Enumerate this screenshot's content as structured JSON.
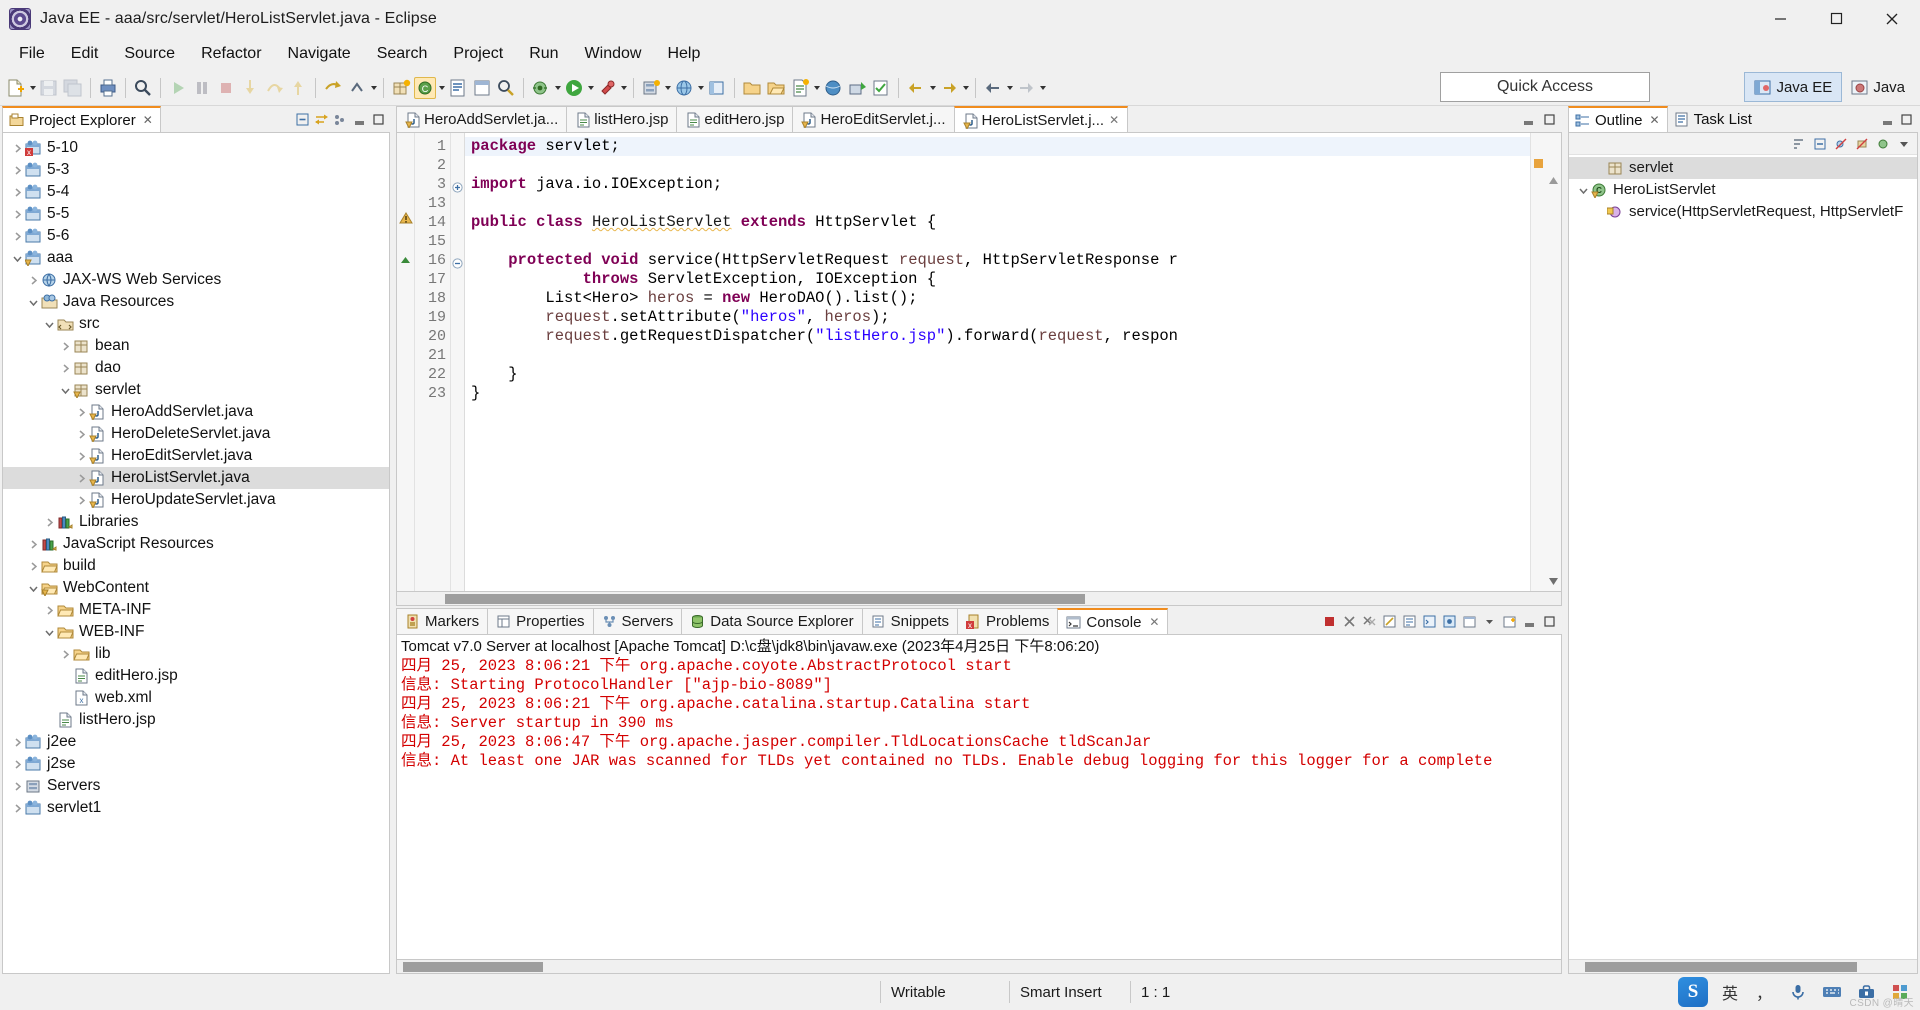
{
  "window": {
    "title": "Java EE - aaa/src/servlet/HeroListServlet.java - Eclipse",
    "minimize_label": "Minimize",
    "maximize_label": "Restore",
    "close_label": "Close"
  },
  "menubar": {
    "items": [
      "File",
      "Edit",
      "Source",
      "Refactor",
      "Navigate",
      "Search",
      "Project",
      "Run",
      "Window",
      "Help"
    ]
  },
  "toolbar": {
    "quick_access_label": "Quick Access",
    "perspectives": [
      {
        "label": "Java EE",
        "active": true
      },
      {
        "label": "Java",
        "active": false
      }
    ]
  },
  "project_explorer": {
    "tab_label": "Project Explorer",
    "tree": [
      {
        "label": "5-10",
        "indent": 0,
        "arrow": "right",
        "icon": "project-error-icon"
      },
      {
        "label": "5-3",
        "indent": 0,
        "arrow": "right",
        "icon": "project-icon"
      },
      {
        "label": "5-4",
        "indent": 0,
        "arrow": "right",
        "icon": "project-icon"
      },
      {
        "label": "5-5",
        "indent": 0,
        "arrow": "right",
        "icon": "project-icon"
      },
      {
        "label": "5-6",
        "indent": 0,
        "arrow": "right",
        "icon": "project-icon"
      },
      {
        "label": "aaa",
        "indent": 0,
        "arrow": "down",
        "icon": "project-warning-icon"
      },
      {
        "label": "JAX-WS Web Services",
        "indent": 1,
        "arrow": "right",
        "icon": "webservice-icon"
      },
      {
        "label": "Java Resources",
        "indent": 1,
        "arrow": "down",
        "icon": "java-resources-icon"
      },
      {
        "label": "src",
        "indent": 2,
        "arrow": "down",
        "icon": "source-folder-icon"
      },
      {
        "label": "bean",
        "indent": 3,
        "arrow": "right",
        "icon": "package-icon"
      },
      {
        "label": "dao",
        "indent": 3,
        "arrow": "right",
        "icon": "package-icon"
      },
      {
        "label": "servlet",
        "indent": 3,
        "arrow": "down",
        "icon": "package-warning-icon"
      },
      {
        "label": "HeroAddServlet.java",
        "indent": 4,
        "arrow": "right",
        "icon": "java-file-warning-icon"
      },
      {
        "label": "HeroDeleteServlet.java",
        "indent": 4,
        "arrow": "right",
        "icon": "java-file-warning-icon"
      },
      {
        "label": "HeroEditServlet.java",
        "indent": 4,
        "arrow": "right",
        "icon": "java-file-warning-icon"
      },
      {
        "label": "HeroListServlet.java",
        "indent": 4,
        "arrow": "right",
        "icon": "java-file-warning-icon",
        "selected": true
      },
      {
        "label": "HeroUpdateServlet.java",
        "indent": 4,
        "arrow": "right",
        "icon": "java-file-warning-icon"
      },
      {
        "label": "Libraries",
        "indent": 2,
        "arrow": "right",
        "icon": "libraries-icon"
      },
      {
        "label": "JavaScript Resources",
        "indent": 1,
        "arrow": "right",
        "icon": "libraries-icon"
      },
      {
        "label": "build",
        "indent": 1,
        "arrow": "right",
        "icon": "folder-icon"
      },
      {
        "label": "WebContent",
        "indent": 1,
        "arrow": "down",
        "icon": "folder-warning-icon"
      },
      {
        "label": "META-INF",
        "indent": 2,
        "arrow": "right",
        "icon": "folder-icon"
      },
      {
        "label": "WEB-INF",
        "indent": 2,
        "arrow": "down",
        "icon": "folder-icon"
      },
      {
        "label": "lib",
        "indent": 3,
        "arrow": "right",
        "icon": "folder-icon"
      },
      {
        "label": "editHero.jsp",
        "indent": 3,
        "arrow": "none",
        "icon": "jsp-file-icon"
      },
      {
        "label": "web.xml",
        "indent": 3,
        "arrow": "none",
        "icon": "xml-file-icon"
      },
      {
        "label": "listHero.jsp",
        "indent": 2,
        "arrow": "none",
        "icon": "jsp-file-icon"
      },
      {
        "label": "j2ee",
        "indent": 0,
        "arrow": "right",
        "icon": "project-icon"
      },
      {
        "label": "j2se",
        "indent": 0,
        "arrow": "right",
        "icon": "project-icon"
      },
      {
        "label": "Servers",
        "indent": 0,
        "arrow": "right",
        "icon": "server-project-icon"
      },
      {
        "label": "servlet1",
        "indent": 0,
        "arrow": "right",
        "icon": "project-icon"
      }
    ]
  },
  "editor": {
    "tabs": [
      {
        "label": "HeroAddServlet.ja...",
        "icon": "java-file-warning-icon",
        "active": false
      },
      {
        "label": "listHero.jsp",
        "icon": "jsp-file-icon",
        "active": false
      },
      {
        "label": "editHero.jsp",
        "icon": "jsp-file-icon",
        "active": false
      },
      {
        "label": "HeroEditServlet.j...",
        "icon": "java-file-warning-icon",
        "active": false
      },
      {
        "label": "HeroListServlet.j...",
        "icon": "java-file-warning-icon",
        "active": true
      }
    ],
    "lines": [
      {
        "num": "1",
        "fold": "none",
        "marker": "none",
        "highlight": true,
        "tokens": [
          {
            "t": "package",
            "c": "kw"
          },
          {
            "t": " servlet;",
            "c": "plain"
          }
        ]
      },
      {
        "num": "2",
        "fold": "none",
        "marker": "none",
        "tokens": []
      },
      {
        "num": "3",
        "fold": "collapsed",
        "marker": "none",
        "tokens": [
          {
            "t": "import",
            "c": "kw"
          },
          {
            "t": " java.io.IOException;",
            "c": "plain"
          }
        ]
      },
      {
        "num": "13",
        "fold": "none",
        "marker": "none",
        "tokens": []
      },
      {
        "num": "14",
        "fold": "none",
        "marker": "warning",
        "tokens": [
          {
            "t": "public",
            "c": "kw"
          },
          {
            "t": " ",
            "c": "plain"
          },
          {
            "t": "class",
            "c": "kw"
          },
          {
            "t": " ",
            "c": "plain"
          },
          {
            "t": "HeroListServlet",
            "c": "squiggle"
          },
          {
            "t": " ",
            "c": "plain"
          },
          {
            "t": "extends",
            "c": "kw"
          },
          {
            "t": " HttpServlet {",
            "c": "plain"
          }
        ]
      },
      {
        "num": "15",
        "fold": "none",
        "marker": "none",
        "tokens": []
      },
      {
        "num": "16",
        "fold": "expanded",
        "marker": "override",
        "tokens": [
          {
            "t": "    ",
            "c": "plain"
          },
          {
            "t": "protected",
            "c": "kw"
          },
          {
            "t": " ",
            "c": "plain"
          },
          {
            "t": "void",
            "c": "kw"
          },
          {
            "t": " service(HttpServletRequest ",
            "c": "plain"
          },
          {
            "t": "request",
            "c": "param"
          },
          {
            "t": ", HttpServletResponse r",
            "c": "plain"
          }
        ]
      },
      {
        "num": "17",
        "fold": "none",
        "marker": "none",
        "tokens": [
          {
            "t": "            ",
            "c": "plain"
          },
          {
            "t": "throws",
            "c": "kw"
          },
          {
            "t": " ServletException, IOException {",
            "c": "plain"
          }
        ]
      },
      {
        "num": "18",
        "fold": "none",
        "marker": "none",
        "tokens": [
          {
            "t": "        List<Hero> ",
            "c": "plain"
          },
          {
            "t": "heros",
            "c": "param"
          },
          {
            "t": " = ",
            "c": "plain"
          },
          {
            "t": "new",
            "c": "kw"
          },
          {
            "t": " HeroDAO().list();",
            "c": "plain"
          }
        ]
      },
      {
        "num": "19",
        "fold": "none",
        "marker": "none",
        "tokens": [
          {
            "t": "        ",
            "c": "plain"
          },
          {
            "t": "request",
            "c": "param"
          },
          {
            "t": ".setAttribute(",
            "c": "plain"
          },
          {
            "t": "\"heros\"",
            "c": "str"
          },
          {
            "t": ", ",
            "c": "plain"
          },
          {
            "t": "heros",
            "c": "param"
          },
          {
            "t": ");",
            "c": "plain"
          }
        ]
      },
      {
        "num": "20",
        "fold": "none",
        "marker": "none",
        "tokens": [
          {
            "t": "        ",
            "c": "plain"
          },
          {
            "t": "request",
            "c": "param"
          },
          {
            "t": ".getRequestDispatcher(",
            "c": "plain"
          },
          {
            "t": "\"listHero.jsp\"",
            "c": "str"
          },
          {
            "t": ").forward(",
            "c": "plain"
          },
          {
            "t": "request",
            "c": "param"
          },
          {
            "t": ", respon",
            "c": "plain"
          }
        ]
      },
      {
        "num": "21",
        "fold": "none",
        "marker": "none",
        "tokens": []
      },
      {
        "num": "22",
        "fold": "none",
        "marker": "none",
        "tokens": [
          {
            "t": "    }",
            "c": "plain"
          }
        ]
      },
      {
        "num": "23",
        "fold": "none",
        "marker": "none",
        "tokens": [
          {
            "t": "}",
            "c": "plain"
          }
        ]
      }
    ]
  },
  "outline": {
    "tabs": [
      {
        "label": "Outline",
        "icon": "outline-icon",
        "active": true
      },
      {
        "label": "Task List",
        "icon": "tasklist-icon",
        "active": false
      }
    ],
    "items": [
      {
        "label": "servlet",
        "indent": 1,
        "arrow": "none",
        "icon": "package-icon",
        "selected": true
      },
      {
        "label": "HeroListServlet",
        "indent": 0,
        "arrow": "down",
        "icon": "class-warning-icon"
      },
      {
        "label": "service(HttpServletRequest, HttpServletF",
        "indent": 1,
        "arrow": "none",
        "icon": "method-protected-icon"
      }
    ]
  },
  "bottom_panel": {
    "tabs": [
      {
        "label": "Markers",
        "icon": "markers-icon",
        "active": false
      },
      {
        "label": "Properties",
        "icon": "properties-icon",
        "active": false
      },
      {
        "label": "Servers",
        "icon": "servers-icon",
        "active": false
      },
      {
        "label": "Data Source Explorer",
        "icon": "datasource-icon",
        "active": false
      },
      {
        "label": "Snippets",
        "icon": "snippets-icon",
        "active": false
      },
      {
        "label": "Problems",
        "icon": "problems-icon",
        "active": false
      },
      {
        "label": "Console",
        "icon": "console-icon",
        "active": true
      }
    ],
    "console_header": "Tomcat v7.0 Server at localhost [Apache Tomcat] D:\\c盘\\jdk8\\bin\\javaw.exe (2023年4月25日 下午8:06:20)",
    "console_lines": [
      "四月 25, 2023 8:06:21 下午 org.apache.coyote.AbstractProtocol start",
      "信息: Starting ProtocolHandler [\"ajp-bio-8089\"]",
      "四月 25, 2023 8:06:21 下午 org.apache.catalina.startup.Catalina start",
      "信息: Server startup in 390 ms",
      "四月 25, 2023 8:06:47 下午 org.apache.jasper.compiler.TldLocationsCache tldScanJar",
      "信息: At least one JAR was scanned for TLDs yet contained no TLDs. Enable debug logging for this logger for a complete"
    ]
  },
  "statusbar": {
    "writable": "Writable",
    "insert_mode": "Smart Insert",
    "position": "1 : 1",
    "ime": {
      "logo": "S",
      "lang": "英",
      "punct": "，",
      "mic": "mic-icon",
      "keyboard": "keyboard-icon",
      "toolbox": "toolbox-icon",
      "menu": "menu-icon"
    },
    "watermark": "CSDN @晴天"
  },
  "colors": {
    "accent_orange": "#f08c1e",
    "selection_gray": "#dcdcdc",
    "console_red": "#d30000",
    "keyword_purple": "#7f0055",
    "string_blue": "#2a00ff",
    "chrome_gray": "#f0f0f0"
  }
}
